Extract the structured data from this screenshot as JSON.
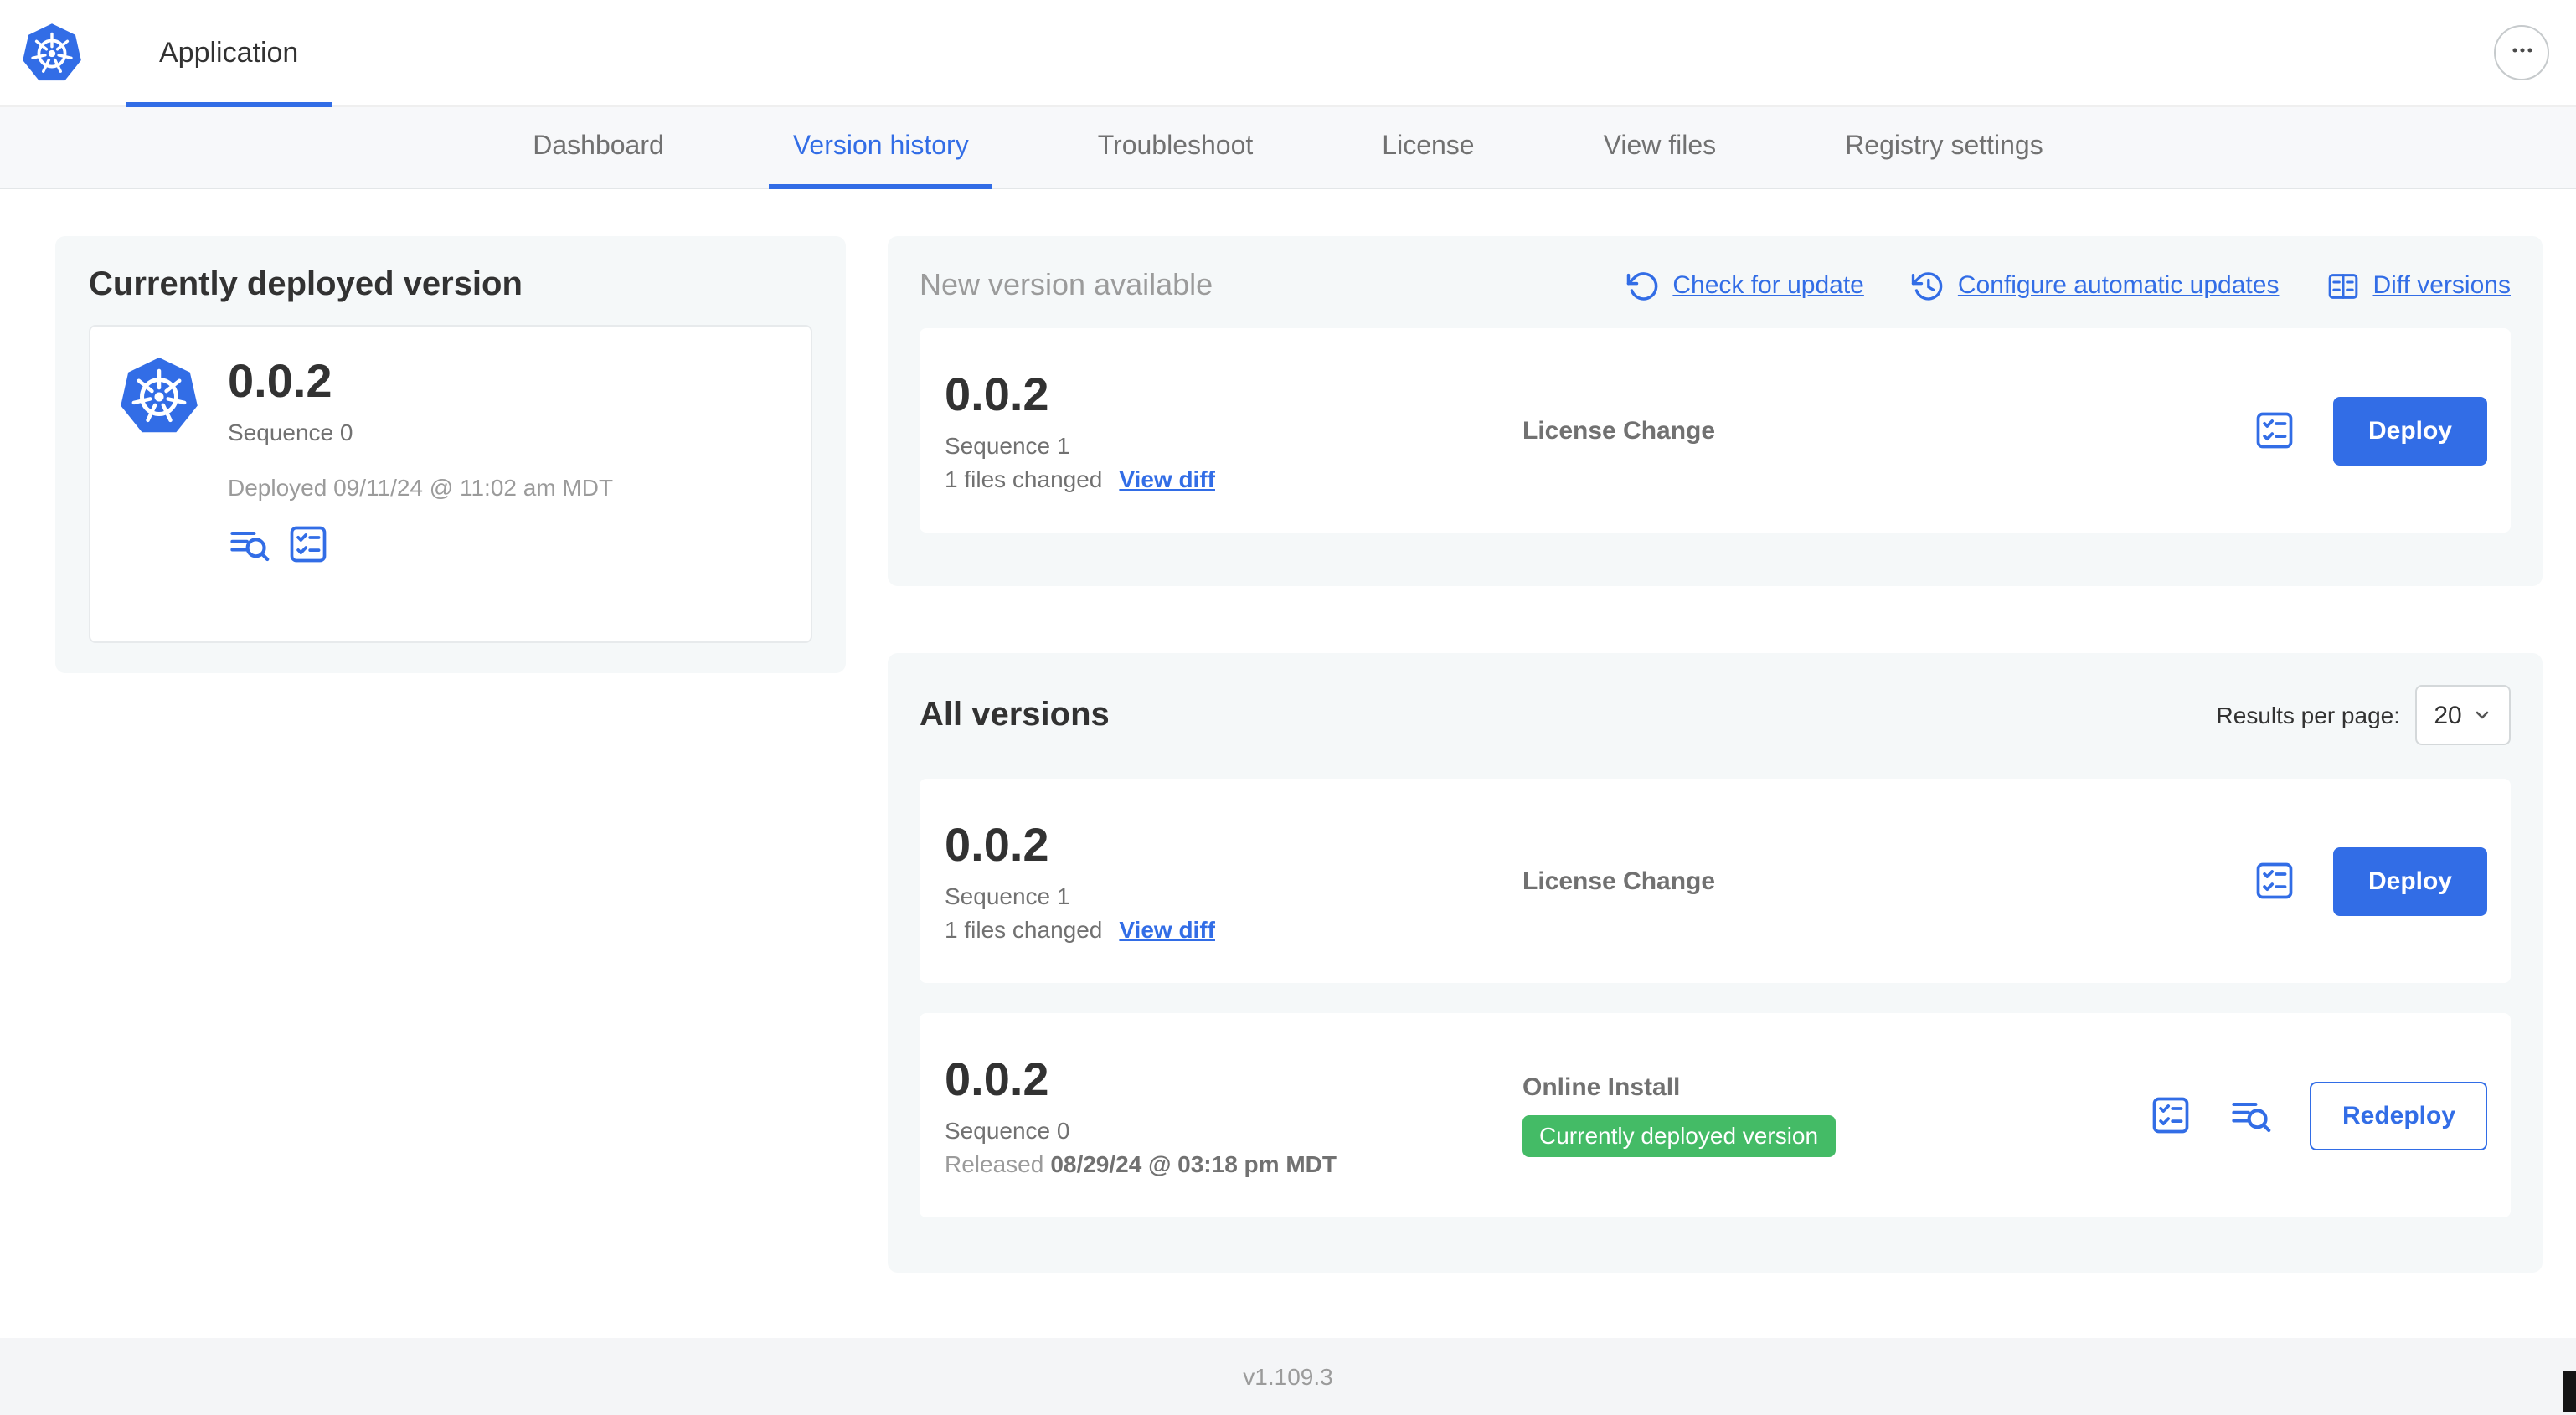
{
  "colors": {
    "primary": "#326de6",
    "badge_green": "#44bb66",
    "panel_gray": "#f5f8f9"
  },
  "topbar": {
    "app_name": "Application"
  },
  "nav": {
    "active_tab": "Version history",
    "tabs": [
      {
        "label": "Dashboard"
      },
      {
        "label": "Version history"
      },
      {
        "label": "Troubleshoot"
      },
      {
        "label": "License"
      },
      {
        "label": "View files"
      },
      {
        "label": "Registry settings"
      }
    ]
  },
  "current_version": {
    "title": "Currently deployed version",
    "version": "0.0.2",
    "sequence": "Sequence 0",
    "deployed": "Deployed 09/11/24 @ 11:02 am MDT"
  },
  "new_version": {
    "title": "New version available",
    "check_for_update_label": "Check for update",
    "configure_auto_updates_label": "Configure automatic updates",
    "diff_versions_label": "Diff versions",
    "row": {
      "version": "0.0.2",
      "sequence": "Sequence 1",
      "files_changed": "1 files changed",
      "view_diff_label": "View diff",
      "source": "License Change",
      "action_label": "Deploy"
    }
  },
  "all_versions": {
    "title": "All versions",
    "results_per_page_label": "Results per page:",
    "results_per_page_value": "20",
    "rows": [
      {
        "version": "0.0.2",
        "sequence": "Sequence 1",
        "files_changed": "1 files changed",
        "view_diff_label": "View diff",
        "source": "License Change",
        "action_label": "Deploy"
      },
      {
        "version": "0.0.2",
        "sequence": "Sequence 0",
        "released_prefix": "Released",
        "released_date": "08/29/24 @ 03:18 pm MDT",
        "source": "Online Install",
        "badge": "Currently deployed version",
        "action_label": "Redeploy"
      }
    ]
  },
  "footer": {
    "app_version": "v1.109.3"
  },
  "icons": {
    "logo": "kubernetes-logo",
    "more": "ellipsis-circle-icon",
    "check_update": "refresh-ccw-icon",
    "auto_update": "history-clock-icon",
    "diff": "diff-table-icon",
    "logs": "view-logs-icon",
    "checklist": "release-notes-checklist-icon",
    "select_chevron": "chevron-down-icon"
  }
}
